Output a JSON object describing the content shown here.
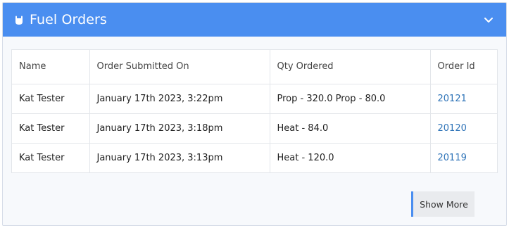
{
  "panel": {
    "title": "Fuel Orders",
    "icon": "fuel-drop-icon",
    "collapse_icon": "chevron-down-icon",
    "accent_color": "#4a8ef0"
  },
  "table": {
    "columns": [
      "Name",
      "Order Submitted On",
      "Qty Ordered",
      "Order Id"
    ],
    "rows": [
      {
        "name": "Kat Tester",
        "submitted": "January 17th 2023, 3:22pm",
        "qty": "Prop - 320.0 Prop - 80.0",
        "order_id": "20121"
      },
      {
        "name": "Kat Tester",
        "submitted": "January 17th 2023, 3:18pm",
        "qty": "Heat - 84.0",
        "order_id": "20120"
      },
      {
        "name": "Kat Tester",
        "submitted": "January 17th 2023, 3:13pm",
        "qty": "Heat - 120.0",
        "order_id": "20119"
      }
    ]
  },
  "actions": {
    "show_more_label": "Show More"
  }
}
